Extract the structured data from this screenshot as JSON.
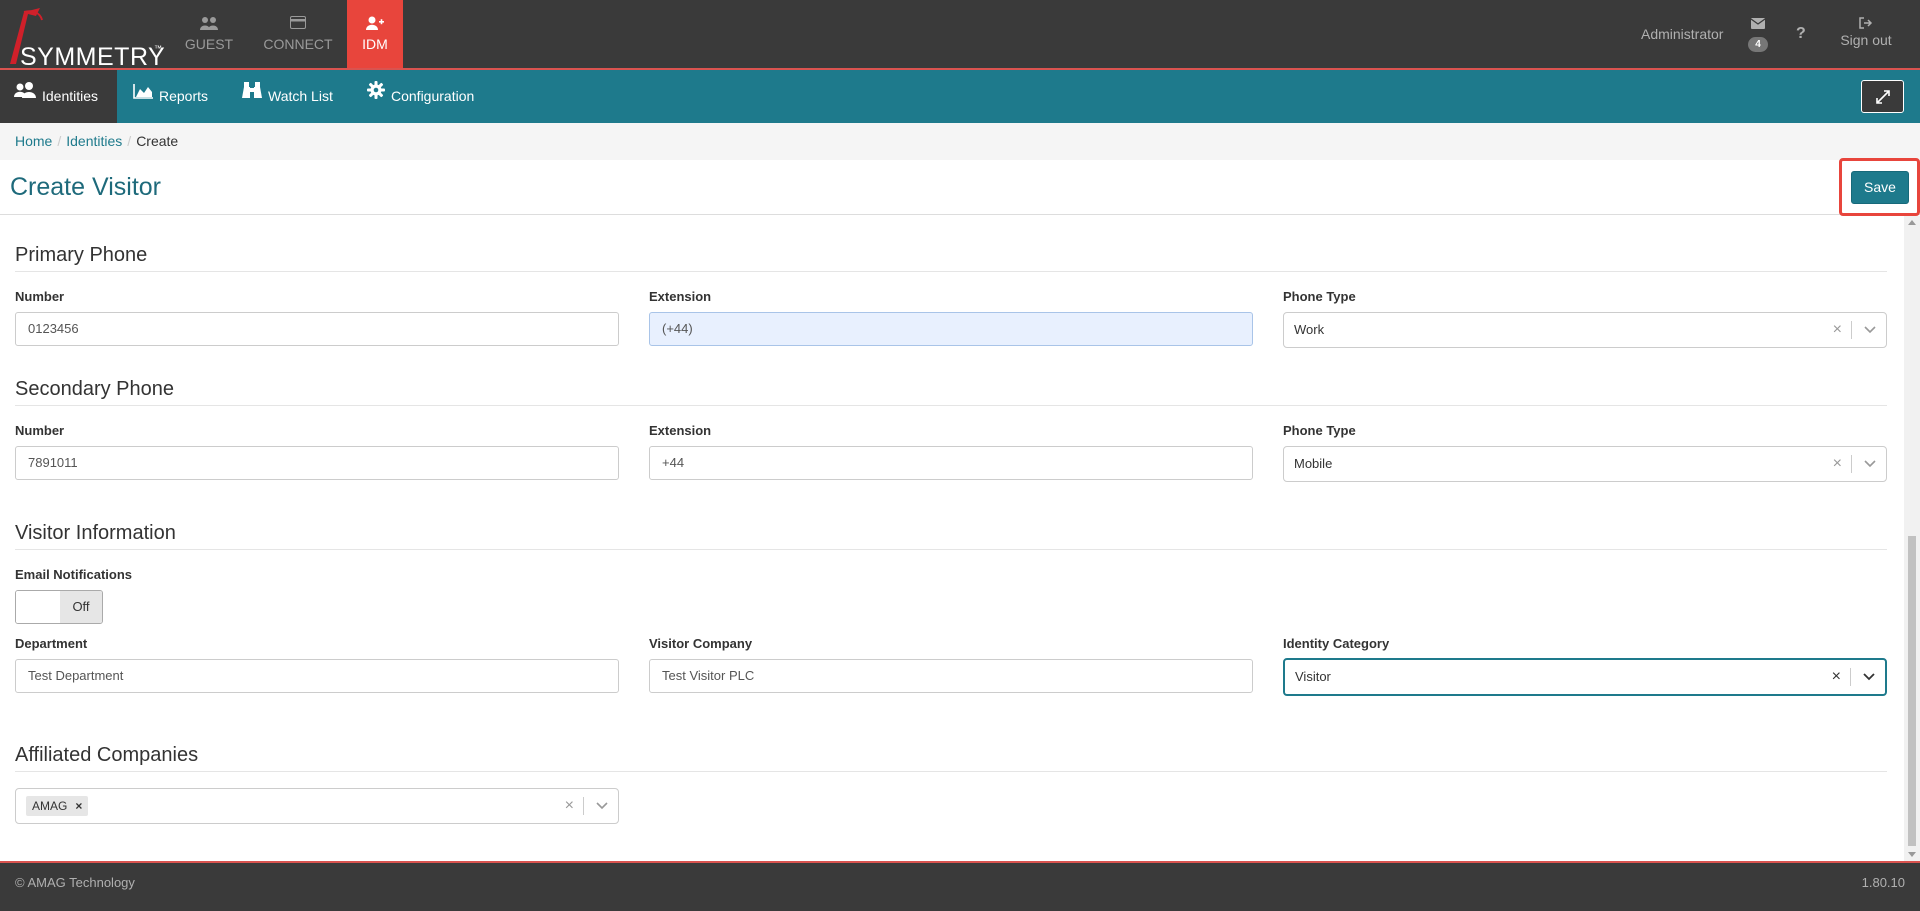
{
  "brand": {
    "name": "SYMMETRY",
    "tm": "™"
  },
  "app_tabs": [
    {
      "label": "GUEST",
      "icon": "users-icon"
    },
    {
      "label": "CONNECT",
      "icon": "card-icon"
    },
    {
      "label": "IDM",
      "icon": "add-user-icon",
      "active": true
    }
  ],
  "user": {
    "name": "Administrator",
    "mail_count": "4",
    "help": "?",
    "signout": "Sign out"
  },
  "nav": {
    "identities": "Identities",
    "reports": "Reports",
    "watch_list": "Watch List",
    "configuration": "Configuration"
  },
  "breadcrumb": {
    "home": "Home",
    "identities": "Identities",
    "current": "Create"
  },
  "page": {
    "title": "Create Visitor",
    "save_label": "Save"
  },
  "primary_phone": {
    "title": "Primary Phone",
    "number_label": "Number",
    "number": "0123456",
    "extension_label": "Extension",
    "extension": "(+44)",
    "type_label": "Phone Type",
    "type": "Work"
  },
  "secondary_phone": {
    "title": "Secondary Phone",
    "number_label": "Number",
    "number": "7891011",
    "extension_label": "Extension",
    "extension": "+44",
    "type_label": "Phone Type",
    "type": "Mobile"
  },
  "visitor_info": {
    "title": "Visitor Information",
    "email_label": "Email Notifications",
    "email_state": "Off",
    "department_label": "Department",
    "department": "Test Department",
    "company_label": "Visitor Company",
    "company": "Test Visitor PLC",
    "category_label": "Identity Category",
    "category": "Visitor"
  },
  "affiliated": {
    "title": "Affiliated Companies",
    "tags": [
      "AMAG"
    ]
  },
  "footer": {
    "copyright": "© AMAG Technology",
    "version": "1.80.10"
  },
  "colors": {
    "teal": "#1e7a8c",
    "accent_red": "#e8453c",
    "dark": "#3a3a3a"
  }
}
